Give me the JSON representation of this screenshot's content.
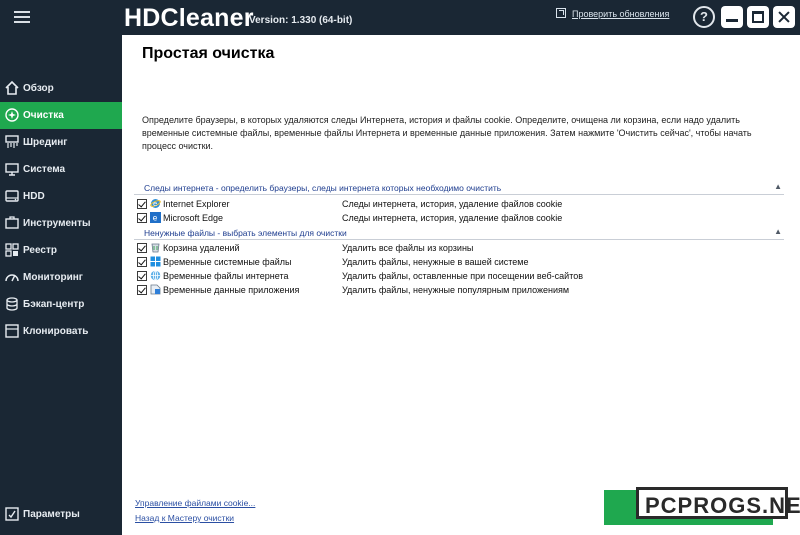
{
  "window": {
    "app_name": "HDCleaner",
    "version": "Version: 1.330 (64-bit)",
    "update_link": "Проверить обновления",
    "help_label": "?"
  },
  "sidebar": {
    "items": [
      {
        "label": "Обзор",
        "icon": "house-icon",
        "active": false
      },
      {
        "label": "Очистка",
        "icon": "sparkle-icon",
        "active": true
      },
      {
        "label": "Шрединг",
        "icon": "shredder-icon",
        "active": false
      },
      {
        "label": "Система",
        "icon": "computer-icon",
        "active": false
      },
      {
        "label": "HDD",
        "icon": "hdd-icon",
        "active": false
      },
      {
        "label": "Инструменты",
        "icon": "tools-icon",
        "active": false
      },
      {
        "label": "Реестр",
        "icon": "registry-icon",
        "active": false
      },
      {
        "label": "Мониторинг",
        "icon": "monitor-icon",
        "active": false
      },
      {
        "label": "Бэкап-центр",
        "icon": "backup-icon",
        "active": false
      },
      {
        "label": "Клонировать",
        "icon": "clone-icon",
        "active": false
      }
    ],
    "settings_label": "Параметры"
  },
  "main": {
    "title": "Простая очистка",
    "description": "Определите браузеры, в которых удаляются следы Интернета, история и файлы cookie. Определите, очищена ли корзина, если надо удалить временные системные файлы, временные файлы Интернета и временные данные приложения. Затем нажмите 'Очистить сейчас', чтобы начать процесс очистки.",
    "sections": [
      {
        "header": "Следы интернета - определить браузеры, следы интернета которых необходимо очистить",
        "rows": [
          {
            "name": "Internet Explorer",
            "desc": "Следы интернета, история, удаление файлов cookie",
            "checked": true,
            "icon": "internet-explorer-icon"
          },
          {
            "name": "Microsoft Edge",
            "desc": "Следы интернета, история, удаление файлов cookie",
            "checked": true,
            "icon": "edge-icon"
          }
        ]
      },
      {
        "header": "Ненужные файлы - выбрать элементы для очистки",
        "rows": [
          {
            "name": "Корзина удалений",
            "desc": "Удалить все файлы из корзины",
            "checked": true,
            "icon": "recycle-bin-icon"
          },
          {
            "name": "Временные системные файлы",
            "desc": "Удалить файлы, ненужные в вашей системе",
            "checked": true,
            "icon": "windows-icon"
          },
          {
            "name": "Временные файлы интернета",
            "desc": "Удалить файлы, оставленные при посещении веб-сайтов",
            "checked": true,
            "icon": "globe-icon"
          },
          {
            "name": "Временные данные приложения",
            "desc": "Удалить файлы, ненужные популярным приложениям",
            "checked": true,
            "icon": "app-data-icon"
          }
        ]
      }
    ],
    "links": {
      "cookies": "Управление файлами cookie...",
      "back": "Назад к  Мастеру очистки"
    }
  },
  "watermark": "PCPROGS.NET",
  "colors": {
    "sidebar_bg": "#1a2734",
    "accent_green": "#1fa84f",
    "section_blue": "#1e3d8f",
    "link_blue": "#2b4fa3"
  }
}
